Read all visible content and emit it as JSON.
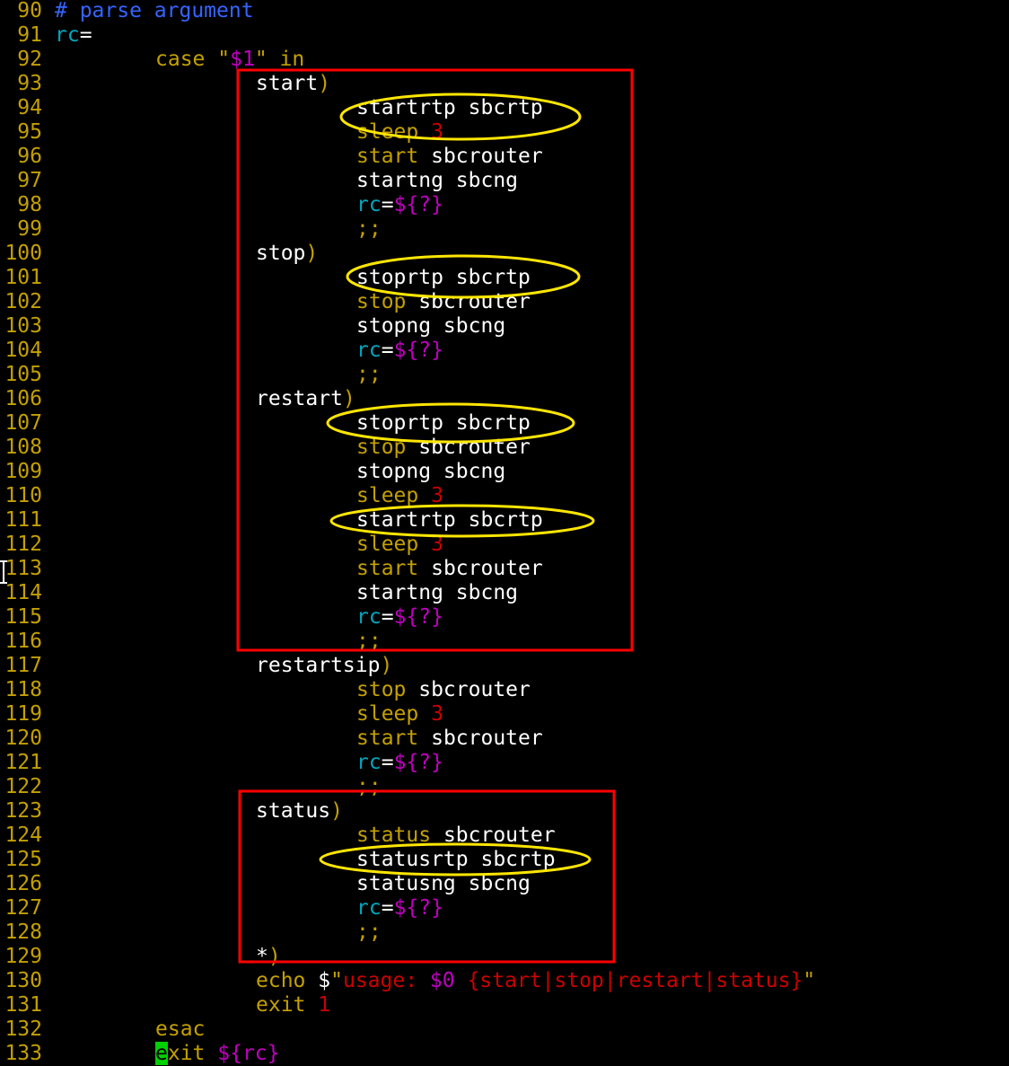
{
  "editor": {
    "colors": {
      "background": "#000000",
      "line_number": "#c4a000",
      "default": "#ffffff",
      "comment": "#3465ff",
      "keyword": "#c4a000",
      "string": "#cc0000",
      "variable": "#c000c0",
      "identifier": "#00a8c0",
      "cursor": "#00d000",
      "annotation_box": "#ff0000",
      "annotation_ellipse": "#ffe600"
    },
    "cursor": {
      "line": 133,
      "column": 9,
      "char": "e"
    },
    "lines": [
      {
        "no": "90",
        "indent": 0,
        "tokens": [
          {
            "t": "# parse argument",
            "c": "comment"
          }
        ]
      },
      {
        "no": "91",
        "indent": 0,
        "tokens": [
          {
            "t": "rc",
            "c": "identifier"
          },
          {
            "t": "=",
            "c": "default"
          }
        ]
      },
      {
        "no": "92",
        "indent": 8,
        "tokens": [
          {
            "t": "case ",
            "c": "keyword"
          },
          {
            "t": "\"",
            "c": "keyword"
          },
          {
            "t": "$1",
            "c": "variable"
          },
          {
            "t": "\"",
            "c": "keyword"
          },
          {
            "t": " in",
            "c": "keyword"
          }
        ]
      },
      {
        "no": "93",
        "indent": 16,
        "tokens": [
          {
            "t": "start",
            "c": "default"
          },
          {
            "t": ")",
            "c": "keyword"
          }
        ]
      },
      {
        "no": "94",
        "indent": 24,
        "tokens": [
          {
            "t": "startrtp sbcrtp",
            "c": "default"
          }
        ]
      },
      {
        "no": "95",
        "indent": 24,
        "tokens": [
          {
            "t": "sleep ",
            "c": "keyword"
          },
          {
            "t": "3",
            "c": "string"
          }
        ]
      },
      {
        "no": "96",
        "indent": 24,
        "tokens": [
          {
            "t": "start",
            "c": "keyword"
          },
          {
            "t": " sbcrouter",
            "c": "default"
          }
        ]
      },
      {
        "no": "97",
        "indent": 24,
        "tokens": [
          {
            "t": "startng sbcng",
            "c": "default"
          }
        ]
      },
      {
        "no": "98",
        "indent": 24,
        "tokens": [
          {
            "t": "rc",
            "c": "identifier"
          },
          {
            "t": "=",
            "c": "default"
          },
          {
            "t": "${?}",
            "c": "variable"
          }
        ]
      },
      {
        "no": "99",
        "indent": 24,
        "tokens": [
          {
            "t": ";;",
            "c": "keyword"
          }
        ]
      },
      {
        "no": "100",
        "indent": 16,
        "tokens": [
          {
            "t": "stop",
            "c": "default"
          },
          {
            "t": ")",
            "c": "keyword"
          }
        ]
      },
      {
        "no": "101",
        "indent": 24,
        "tokens": [
          {
            "t": "stoprtp sbcrtp",
            "c": "default"
          }
        ]
      },
      {
        "no": "102",
        "indent": 24,
        "tokens": [
          {
            "t": "stop",
            "c": "keyword"
          },
          {
            "t": " sbcrouter",
            "c": "default"
          }
        ]
      },
      {
        "no": "103",
        "indent": 24,
        "tokens": [
          {
            "t": "stopng sbcng",
            "c": "default"
          }
        ]
      },
      {
        "no": "104",
        "indent": 24,
        "tokens": [
          {
            "t": "rc",
            "c": "identifier"
          },
          {
            "t": "=",
            "c": "default"
          },
          {
            "t": "${?}",
            "c": "variable"
          }
        ]
      },
      {
        "no": "105",
        "indent": 24,
        "tokens": [
          {
            "t": ";;",
            "c": "keyword"
          }
        ]
      },
      {
        "no": "106",
        "indent": 16,
        "tokens": [
          {
            "t": "restart",
            "c": "default"
          },
          {
            "t": ")",
            "c": "keyword"
          }
        ]
      },
      {
        "no": "107",
        "indent": 24,
        "tokens": [
          {
            "t": "stoprtp sbcrtp",
            "c": "default"
          }
        ]
      },
      {
        "no": "108",
        "indent": 24,
        "tokens": [
          {
            "t": "stop",
            "c": "keyword"
          },
          {
            "t": " sbcrouter",
            "c": "default"
          }
        ]
      },
      {
        "no": "109",
        "indent": 24,
        "tokens": [
          {
            "t": "stopng sbcng",
            "c": "default"
          }
        ]
      },
      {
        "no": "110",
        "indent": 24,
        "tokens": [
          {
            "t": "sleep ",
            "c": "keyword"
          },
          {
            "t": "3",
            "c": "string"
          }
        ]
      },
      {
        "no": "111",
        "indent": 24,
        "tokens": [
          {
            "t": "startrtp sbcrtp",
            "c": "default"
          }
        ]
      },
      {
        "no": "112",
        "indent": 24,
        "tokens": [
          {
            "t": "sleep ",
            "c": "keyword"
          },
          {
            "t": "3",
            "c": "string"
          }
        ]
      },
      {
        "no": "113",
        "indent": 24,
        "tokens": [
          {
            "t": "start",
            "c": "keyword"
          },
          {
            "t": " sbcrouter",
            "c": "default"
          }
        ]
      },
      {
        "no": "114",
        "indent": 24,
        "tokens": [
          {
            "t": "startng sbcng",
            "c": "default"
          }
        ]
      },
      {
        "no": "115",
        "indent": 24,
        "tokens": [
          {
            "t": "rc",
            "c": "identifier"
          },
          {
            "t": "=",
            "c": "default"
          },
          {
            "t": "${?}",
            "c": "variable"
          }
        ]
      },
      {
        "no": "116",
        "indent": 24,
        "tokens": [
          {
            "t": ";;",
            "c": "keyword"
          }
        ]
      },
      {
        "no": "117",
        "indent": 16,
        "tokens": [
          {
            "t": "restartsip",
            "c": "default"
          },
          {
            "t": ")",
            "c": "keyword"
          }
        ]
      },
      {
        "no": "118",
        "indent": 24,
        "tokens": [
          {
            "t": "stop",
            "c": "keyword"
          },
          {
            "t": " sbcrouter",
            "c": "default"
          }
        ]
      },
      {
        "no": "119",
        "indent": 24,
        "tokens": [
          {
            "t": "sleep ",
            "c": "keyword"
          },
          {
            "t": "3",
            "c": "string"
          }
        ]
      },
      {
        "no": "120",
        "indent": 24,
        "tokens": [
          {
            "t": "start",
            "c": "keyword"
          },
          {
            "t": " sbcrouter",
            "c": "default"
          }
        ]
      },
      {
        "no": "121",
        "indent": 24,
        "tokens": [
          {
            "t": "rc",
            "c": "identifier"
          },
          {
            "t": "=",
            "c": "default"
          },
          {
            "t": "${?}",
            "c": "variable"
          }
        ]
      },
      {
        "no": "122",
        "indent": 24,
        "tokens": [
          {
            "t": ";;",
            "c": "keyword"
          }
        ]
      },
      {
        "no": "123",
        "indent": 16,
        "tokens": [
          {
            "t": "status",
            "c": "default"
          },
          {
            "t": ")",
            "c": "keyword"
          }
        ]
      },
      {
        "no": "124",
        "indent": 24,
        "tokens": [
          {
            "t": "status",
            "c": "keyword"
          },
          {
            "t": " sbcrouter",
            "c": "default"
          }
        ]
      },
      {
        "no": "125",
        "indent": 24,
        "tokens": [
          {
            "t": "statusrtp sbcrtp",
            "c": "default"
          }
        ]
      },
      {
        "no": "126",
        "indent": 24,
        "tokens": [
          {
            "t": "statusng sbcng",
            "c": "default"
          }
        ]
      },
      {
        "no": "127",
        "indent": 24,
        "tokens": [
          {
            "t": "rc",
            "c": "identifier"
          },
          {
            "t": "=",
            "c": "default"
          },
          {
            "t": "${?}",
            "c": "variable"
          }
        ]
      },
      {
        "no": "128",
        "indent": 24,
        "tokens": [
          {
            "t": ";;",
            "c": "keyword"
          }
        ]
      },
      {
        "no": "129",
        "indent": 16,
        "tokens": [
          {
            "t": "*",
            "c": "default"
          },
          {
            "t": ")",
            "c": "keyword"
          }
        ]
      },
      {
        "no": "130",
        "indent": 16,
        "tokens": [
          {
            "t": "echo ",
            "c": "keyword"
          },
          {
            "t": "$",
            "c": "default"
          },
          {
            "t": "\"",
            "c": "keyword"
          },
          {
            "t": "usage: ",
            "c": "string"
          },
          {
            "t": "$0",
            "c": "variable"
          },
          {
            "t": " {start|stop|restart|status}",
            "c": "string"
          },
          {
            "t": "\"",
            "c": "keyword"
          }
        ]
      },
      {
        "no": "131",
        "indent": 16,
        "tokens": [
          {
            "t": "exit ",
            "c": "keyword"
          },
          {
            "t": "1",
            "c": "string"
          }
        ]
      },
      {
        "no": "132",
        "indent": 8,
        "tokens": [
          {
            "t": "esac",
            "c": "keyword"
          }
        ]
      },
      {
        "no": "133",
        "indent": 8,
        "tokens": [
          {
            "t": "e",
            "c": "cursor"
          },
          {
            "t": "xit ",
            "c": "keyword"
          },
          {
            "t": "${rc}",
            "c": "variable"
          }
        ]
      }
    ]
  }
}
